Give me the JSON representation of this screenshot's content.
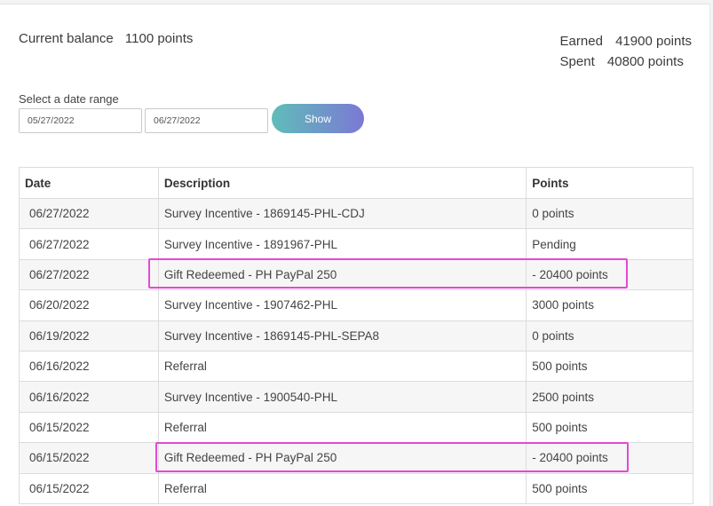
{
  "summary": {
    "balance_label": "Current balance",
    "balance_value": "1100 points",
    "earned_label": "Earned",
    "earned_value": "41900 points",
    "spent_label": "Spent",
    "spent_value": "40800 points"
  },
  "date_range": {
    "label": "Select a date range",
    "start_value": "05/27/2022",
    "end_value": "06/27/2022",
    "show_label": "Show"
  },
  "table": {
    "headers": [
      "Date",
      "Description",
      "Points"
    ],
    "rows": [
      {
        "date": "06/27/2022",
        "description": "Survey Incentive - 1869145-PHL-CDJ",
        "points": "0 points"
      },
      {
        "date": "06/27/2022",
        "description": "Survey Incentive - 1891967-PHL",
        "points": "Pending"
      },
      {
        "date": "06/27/2022",
        "description": "Gift Redeemed - PH PayPal 250",
        "points": "- 20400 points"
      },
      {
        "date": "06/20/2022",
        "description": "Survey Incentive - 1907462-PHL",
        "points": "3000 points"
      },
      {
        "date": "06/19/2022",
        "description": "Survey Incentive - 1869145-PHL-SEPA8",
        "points": "0 points"
      },
      {
        "date": "06/16/2022",
        "description": "Referral",
        "points": "500 points"
      },
      {
        "date": "06/16/2022",
        "description": "Survey Incentive - 1900540-PHL",
        "points": "2500 points"
      },
      {
        "date": "06/15/2022",
        "description": "Referral",
        "points": "500 points"
      },
      {
        "date": "06/15/2022",
        "description": "Gift Redeemed - PH PayPal 250",
        "points": "- 20400 points"
      },
      {
        "date": "06/15/2022",
        "description": "Referral",
        "points": "500 points"
      }
    ]
  },
  "colors": {
    "highlight": "#e548d6",
    "button_gradient_start": "#5fbdb9",
    "button_gradient_end": "#7b78d4"
  }
}
